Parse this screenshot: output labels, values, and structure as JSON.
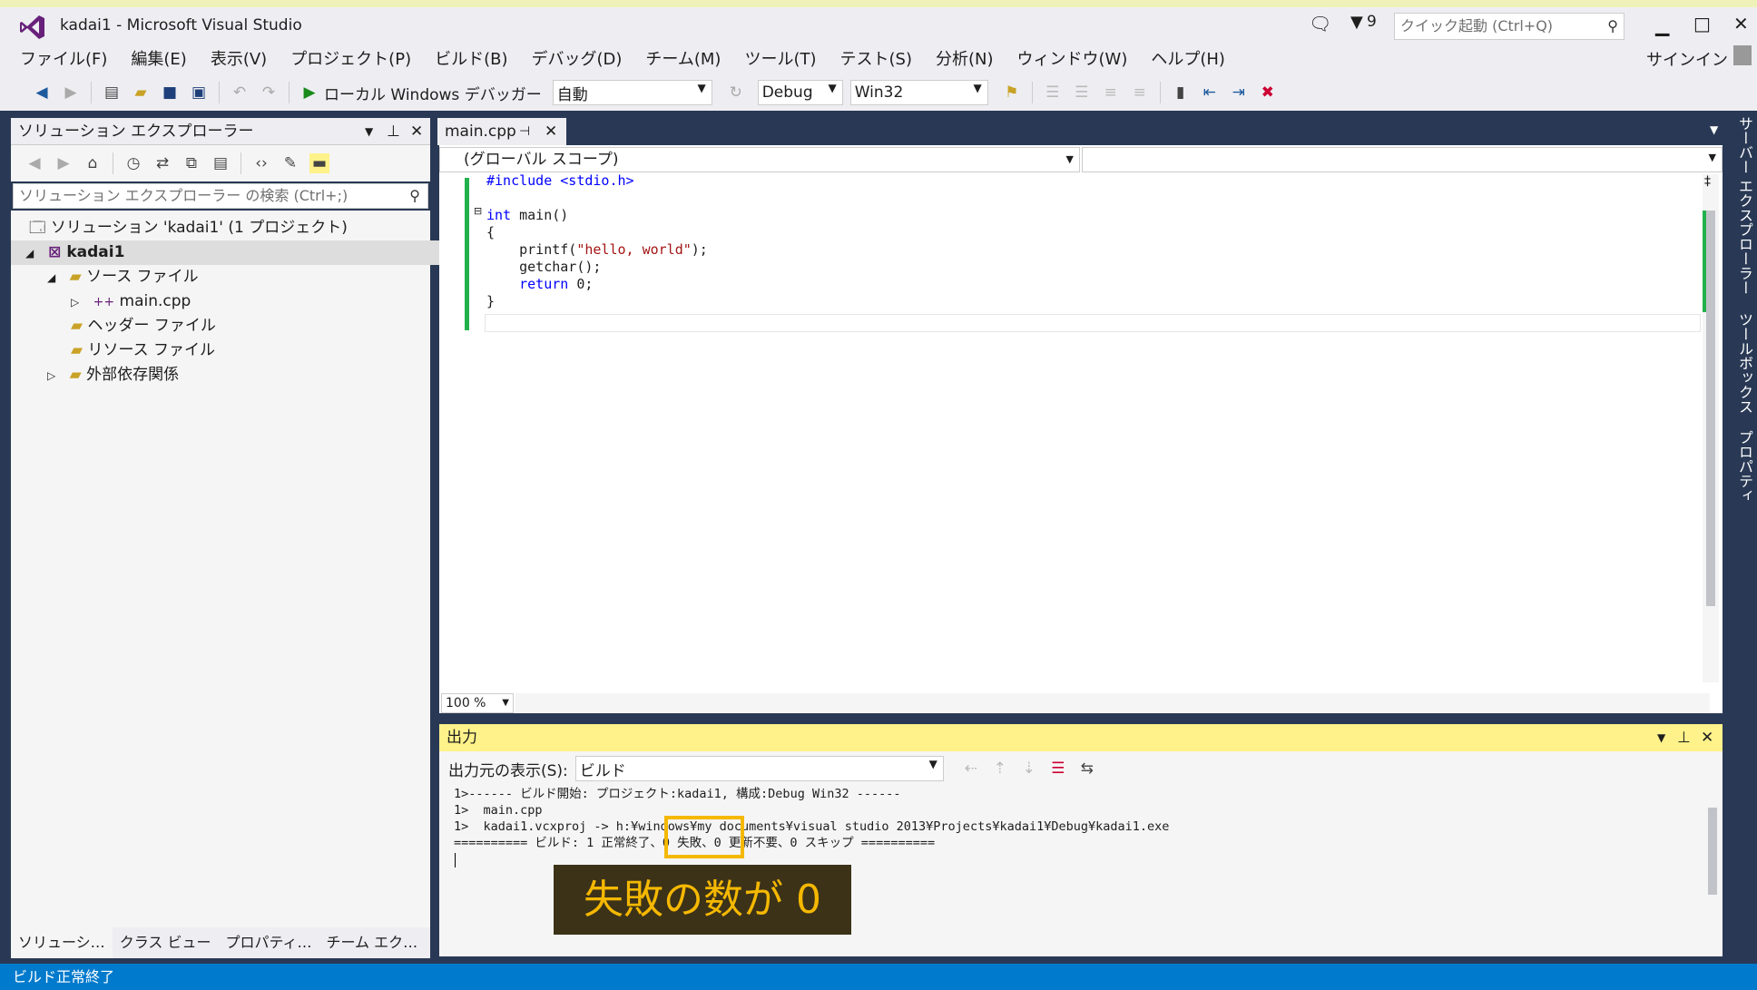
{
  "window": {
    "title": "kadai1 - Microsoft Visual Studio",
    "notif_count": "9",
    "quick_launch_placeholder": "クイック起動 (Ctrl+Q)",
    "signin": "サインイン",
    "icons": [
      "vs-logo-icon",
      "feedback-icon",
      "filter-icon",
      "search-icon",
      "minimize-icon",
      "maximize-icon",
      "close-icon"
    ]
  },
  "menu": [
    "ファイル(F)",
    "編集(E)",
    "表示(V)",
    "プロジェクト(P)",
    "ビルド(B)",
    "デバッグ(D)",
    "チーム(M)",
    "ツール(T)",
    "テスト(S)",
    "分析(N)",
    "ウィンドウ(W)",
    "ヘルプ(H)"
  ],
  "toolbar": {
    "debugger_label": "ローカル Windows デバッガー",
    "auto_combo": "自動",
    "config_combo": "Debug",
    "platform_combo": "Win32"
  },
  "solution_explorer": {
    "title": "ソリューション エクスプローラー",
    "search_placeholder": "ソリューション エクスプローラー の検索 (Ctrl+;)",
    "tree": [
      {
        "label": "ソリューション 'kadai1' (1 プロジェクト)"
      },
      {
        "label": "kadai1"
      },
      {
        "label": "ソース ファイル"
      },
      {
        "label": "main.cpp"
      },
      {
        "label": "ヘッダー ファイル"
      },
      {
        "label": "リソース ファイル"
      },
      {
        "label": "外部依存関係"
      }
    ],
    "tabs": [
      "ソリューシ…",
      "クラス ビュー",
      "プロパティ…",
      "チーム エク…"
    ]
  },
  "editor": {
    "tab": "main.cpp",
    "scope": "(グローバル スコープ)",
    "zoom": "100 %",
    "code": {
      "l1": "#include <stdio.h>",
      "l2_kw": "int",
      "l2_rest": " main()",
      "l3": "{",
      "l4_a": "    printf(",
      "l4_str": "\"hello, world\"",
      "l4_b": ");",
      "l5": "    getchar();",
      "l6_kw": "    return",
      "l6_rest": " 0;",
      "l7": "}"
    }
  },
  "output": {
    "title": "出力",
    "source_label": "出力元の表示(S):",
    "source_value": "ビルド",
    "lines": [
      "1>------ ビルド開始: プロジェクト:kadai1, 構成:Debug Win32 ------",
      "1>  main.cpp",
      "1>  kadai1.vcxproj -> h:¥windows¥my documents¥visual studio 2013¥Projects¥kadai1¥Debug¥kadai1.exe",
      "========== ビルド: 1 正常終了、0 失敗、0 更新不要、0 スキップ =========="
    ],
    "callout": "失敗の数が 0"
  },
  "right_strip": [
    "サーバー エクスプローラー",
    "ツールボックス",
    "プロパティ"
  ],
  "status": "ビルド正常終了",
  "colors": {
    "accent": "#007acc",
    "callout_text": "#f5b800",
    "callout_bg": "#3c3218",
    "output_header": "#fff28a",
    "change_bar": "#22b14c"
  }
}
